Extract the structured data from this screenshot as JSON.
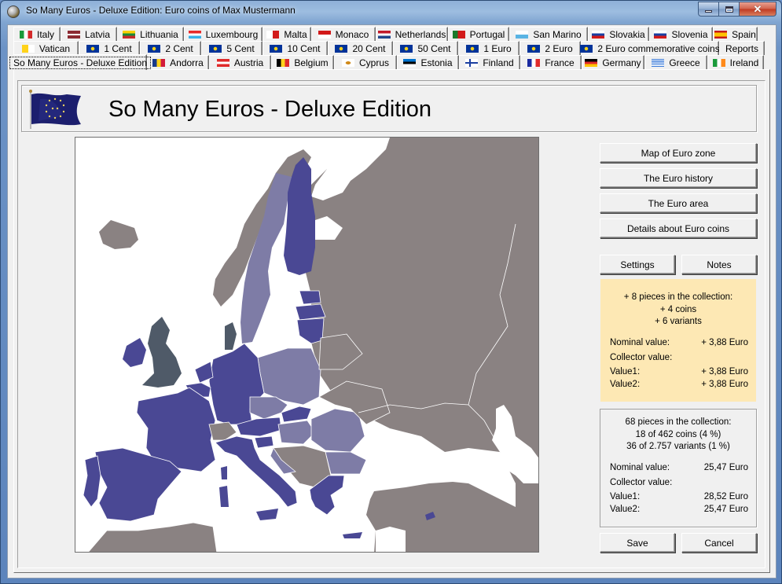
{
  "window": {
    "title": "So Many Euros - Deluxe Edition: Euro coins of Max Mustermann",
    "controls": {
      "minimize": "minimize",
      "maximize": "maximize",
      "close": "close"
    }
  },
  "tabs": {
    "row1": [
      {
        "label": "Italy",
        "flag": "italy-flag"
      },
      {
        "label": "Latvia",
        "flag": "latvia-flag"
      },
      {
        "label": "Lithuania",
        "flag": "lithuania-flag"
      },
      {
        "label": "Luxembourg",
        "flag": "luxembourg-flag"
      },
      {
        "label": "Malta",
        "flag": "malta-flag"
      },
      {
        "label": "Monaco",
        "flag": "monaco-flag"
      },
      {
        "label": "Netherlands",
        "flag": "netherlands-flag"
      },
      {
        "label": "Portugal",
        "flag": "portugal-flag"
      },
      {
        "label": "San Marino",
        "flag": "san-marino-flag"
      },
      {
        "label": "Slovakia",
        "flag": "slovakia-flag"
      },
      {
        "label": "Slovenia",
        "flag": "slovenia-flag"
      },
      {
        "label": "Spain",
        "flag": "spain-flag"
      }
    ],
    "row2": [
      {
        "label": "Vatican",
        "flag": "vatican-flag"
      },
      {
        "label": "1 Cent",
        "flag": "eu-flag"
      },
      {
        "label": "2 Cent",
        "flag": "eu-flag"
      },
      {
        "label": "5 Cent",
        "flag": "eu-flag"
      },
      {
        "label": "10 Cent",
        "flag": "eu-flag"
      },
      {
        "label": "20 Cent",
        "flag": "eu-flag"
      },
      {
        "label": "50 Cent",
        "flag": "eu-flag"
      },
      {
        "label": "1 Euro",
        "flag": "eu-flag"
      },
      {
        "label": "2 Euro",
        "flag": "eu-flag"
      },
      {
        "label": "2 Euro commemorative coins",
        "flag": "eu-flag"
      },
      {
        "label": "Reports",
        "flag": ""
      }
    ],
    "row3": [
      {
        "label": "So Many Euros - Deluxe Edition",
        "flag": "",
        "active": true
      },
      {
        "label": "Andorra",
        "flag": "andorra-flag"
      },
      {
        "label": "Austria",
        "flag": "austria-flag"
      },
      {
        "label": "Belgium",
        "flag": "belgium-flag"
      },
      {
        "label": "Cyprus",
        "flag": "cyprus-flag"
      },
      {
        "label": "Estonia",
        "flag": "estonia-flag"
      },
      {
        "label": "Finland",
        "flag": "finland-flag"
      },
      {
        "label": "France",
        "flag": "france-flag"
      },
      {
        "label": "Germany",
        "flag": "germany-flag"
      },
      {
        "label": "Greece",
        "flag": "greece-flag"
      },
      {
        "label": "Ireland",
        "flag": "ireland-flag"
      }
    ]
  },
  "header": {
    "title": "So Many Euros - Deluxe Edition"
  },
  "map": {
    "legend_colors": {
      "euro_zone": "#4a4894",
      "eu_non_euro": "#7e7ca6",
      "opt_out": "#4f5a68",
      "non_eu": "#8a8282",
      "sea": "#ffffff"
    }
  },
  "buttons": {
    "map_of_euro_zone": "Map of Euro zone",
    "euro_history": "The Euro history",
    "euro_area": "The Euro area",
    "details_euro_coins": "Details about Euro coins",
    "settings": "Settings",
    "notes": "Notes",
    "save": "Save",
    "cancel": "Cancel"
  },
  "new_items": {
    "headline": "+ 8 pieces in the collection:",
    "coins": "+ 4 coins",
    "variants": "+ 6 variants",
    "nominal_label": "Nominal value:",
    "nominal_value": "+ 3,88 Euro",
    "collector_label": "Collector value:",
    "value1_label": "Value1:",
    "value1": "+ 3,88 Euro",
    "value2_label": "Value2:",
    "value2": "+ 3,88 Euro",
    "bg_color": "#fde8b4"
  },
  "collection": {
    "headline": "68 pieces in the collection:",
    "coins": "18 of 462 coins (4 %)",
    "variants": "36 of 2.757 variants (1 %)",
    "nominal_label": "Nominal value:",
    "nominal_value": "25,47 Euro",
    "collector_label": "Collector value:",
    "value1_label": "Value1:",
    "value1": "28,52 Euro",
    "value2_label": "Value2:",
    "value2": "25,47 Euro"
  }
}
